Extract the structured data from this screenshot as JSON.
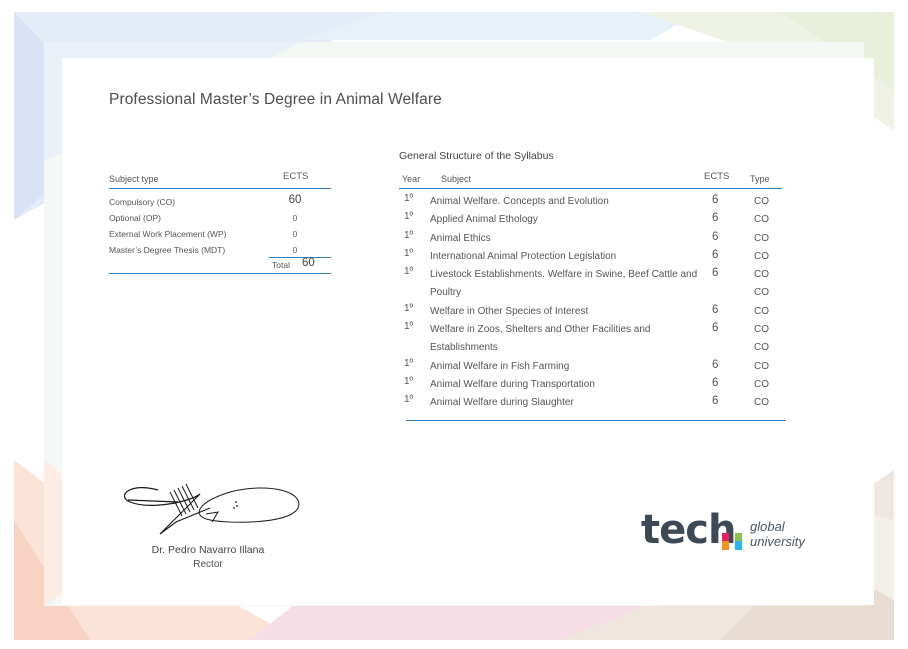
{
  "page_title": "Professional Master’s Degree in Animal Welfare",
  "summary": {
    "header_subject_type": "Subject type",
    "header_ects": "ECTS",
    "rows": [
      {
        "label": "Compulsory (CO)",
        "value": "60"
      },
      {
        "label": "Optional (OP)",
        "value": "0"
      },
      {
        "label": "External Work Placement (WP)",
        "value": "0"
      },
      {
        "label": "Master’s Degree Thesis (MDT)",
        "value": "0"
      }
    ],
    "total_label": "Total",
    "total_value": "60"
  },
  "syllabus": {
    "title": "General Structure of the Syllabus",
    "headers": {
      "year": "Year",
      "subject": "Subject",
      "ects": "ECTS",
      "type": "Type"
    },
    "rows": [
      {
        "year": "1º",
        "subject": "Animal Welfare. Concepts and Evolution",
        "ects": "6",
        "type": "CO"
      },
      {
        "year": "1º",
        "subject": "Applied Animal Ethology",
        "ects": "6",
        "type": "CO"
      },
      {
        "year": "1º",
        "subject": "Animal Ethics",
        "ects": "6",
        "type": "CO"
      },
      {
        "year": "1º",
        "subject": "International Animal Protection Legislation",
        "ects": "6",
        "type": "CO"
      },
      {
        "year": "1º",
        "subject": "Livestock Establishments. Welfare in Swine, Beef Cattle and Poultry",
        "ects": "6",
        "type": "CO",
        "type2": "CO"
      },
      {
        "year": "1º",
        "subject": "Welfare in Other Species of Interest",
        "ects": "6",
        "type": "CO"
      },
      {
        "year": "1º",
        "subject": "Welfare in Zoos, Shelters and Other Facilities and Establishments",
        "ects": "6",
        "type": "CO",
        "type2": "CO"
      },
      {
        "year": "1º",
        "subject": "Animal Welfare in Fish Farming",
        "ects": "6",
        "type": "CO"
      },
      {
        "year": "1º",
        "subject": "Animal Welfare during Transportation",
        "ects": "6",
        "type": "CO"
      },
      {
        "year": "1º",
        "subject": "Animal Welfare during Slaughter",
        "ects": "6",
        "type": "CO"
      }
    ]
  },
  "signature": {
    "name": "Dr. Pedro Navarro Illana",
    "role": "Rector"
  },
  "logo": {
    "word": "tech",
    "sub1": "global",
    "sub2": "university",
    "accent_colors": [
      "#f7941d",
      "#e91e63",
      "#8bc34a",
      "#29b6f6"
    ]
  },
  "colors": {
    "rule_blue": "#2f7fbf",
    "text": "#4a4a4a"
  }
}
